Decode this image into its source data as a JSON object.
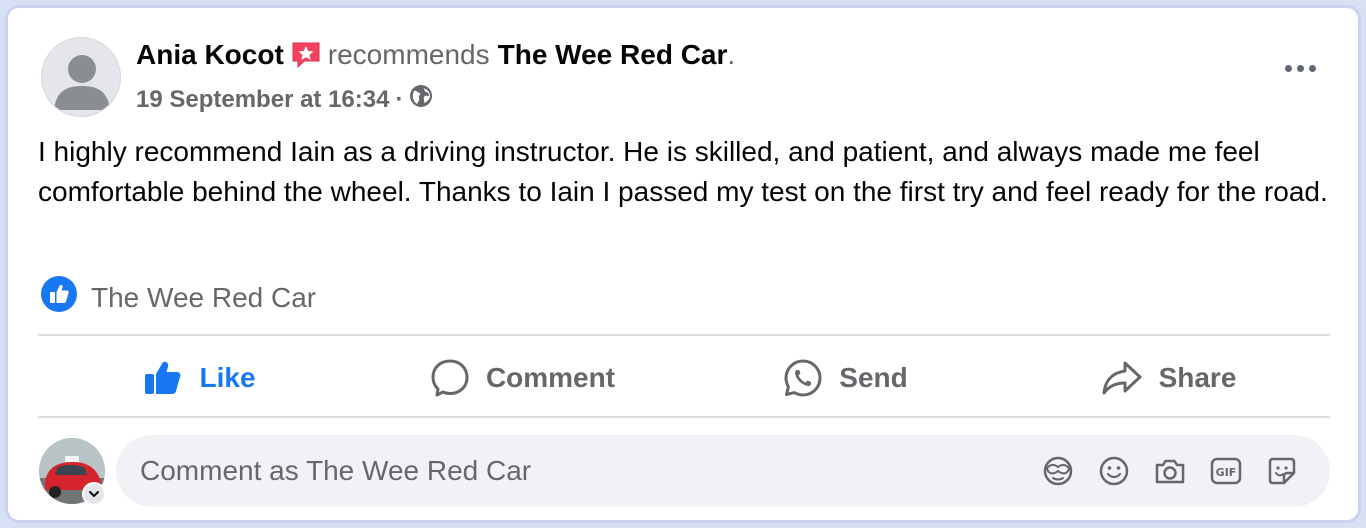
{
  "post": {
    "author": "Ania Kocot",
    "verb": "recommends",
    "page": "The Wee Red Car",
    "period": ".",
    "timestamp": "19 September at 16:34",
    "separator": "·",
    "body": "I highly recommend Iain as a driving instructor. He is skilled, and patient, and always made me feel comfortable behind the wheel. Thanks to Iain I passed my test on the first try and feel ready for the road.",
    "reaction_name": "The Wee Red Car"
  },
  "actions": {
    "like": "Like",
    "comment": "Comment",
    "send": "Send",
    "share": "Share"
  },
  "comment_input": {
    "placeholder": "Comment as The Wee Red Car"
  },
  "icons": {
    "badge": "recommendation-star-icon",
    "privacy": "globe-icon",
    "reaction": "like-reaction-icon",
    "more": "more-options-icon",
    "comment_tools": [
      "avatar-sticker-icon",
      "emoji-icon",
      "camera-icon",
      "gif-icon",
      "sticker-icon"
    ]
  },
  "colors": {
    "accent": "#1877f2",
    "badge": "#f3425f",
    "secondary_text": "#65676b"
  }
}
